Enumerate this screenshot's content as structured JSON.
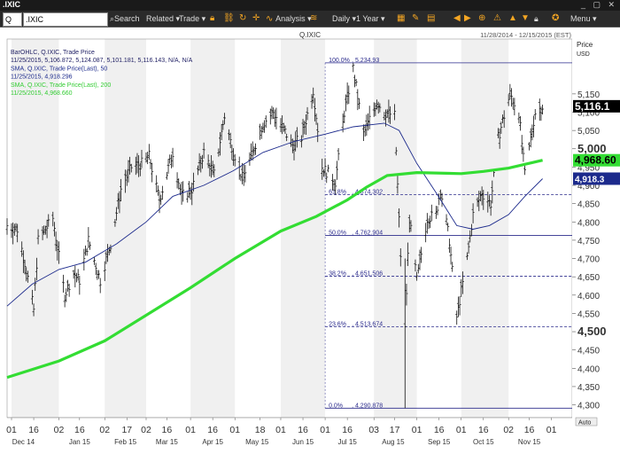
{
  "window": {
    "title": ".IXIC",
    "controls": "_ ▢ ✕"
  },
  "toolbar": {
    "link_indicator": "Q",
    "symbol": ".IXIC",
    "search": "Search",
    "related": "Related ▾",
    "trade": "Trade ▾",
    "analysis": "Analysis ▾",
    "period": "Daily ▾",
    "range": "1 Year ▾",
    "menu": "Menu ▾"
  },
  "chart_data": {
    "type": "line",
    "header": {
      "symbol": "Q.IXIC",
      "date_range": "11/28/2014 - 12/15/2015 (EST)",
      "info_lines": [
        {
          "text": "BarOHLC, Q.IXIC, Trade Price",
          "color": "#222266"
        },
        {
          "text": "11/25/2015, 5,106.872, 5,124.087, 5,101.181, 5,116.143, N/A, N/A",
          "color": "#222266"
        },
        {
          "text": "SMA, Q.IXIC, Trade Price(Last), 50",
          "color": "#1c2a8c"
        },
        {
          "text": "11/25/2015, 4,918.296",
          "color": "#1c2a8c"
        },
        {
          "text": "SMA, Q.IXIC, Trade Price(Last), 200",
          "color": "#33cc33"
        },
        {
          "text": "11/25/2015, 4,968.660",
          "color": "#33cc33"
        }
      ]
    },
    "y_axis": {
      "title": "Price",
      "unit": "USD",
      "ylim": [
        4265,
        5300
      ],
      "ticks": [
        4300,
        4350,
        4400,
        4450,
        4500,
        4550,
        4600,
        4650,
        4700,
        4750,
        4800,
        4850,
        4900,
        4950,
        5000,
        5050,
        5100,
        5150
      ],
      "labels": [
        "4,300",
        "4,350",
        "4,400",
        "4,450",
        "4,500",
        "4,550",
        "4,600",
        "4,650",
        "4,700",
        "4,750",
        "4,800",
        "4,850",
        "4,900",
        "4,950",
        "5,000",
        "5,050",
        "5,100",
        "5,150"
      ],
      "major": [
        4500,
        5000
      ],
      "auto_label": "Auto"
    },
    "x_axis": {
      "start_date": "2014-11-28",
      "end_date": "2015-12-15",
      "day_ticks": [
        {
          "date": "2014-12-01",
          "label": "01"
        },
        {
          "date": "2014-12-16",
          "label": "16"
        },
        {
          "date": "2015-01-02",
          "label": "02"
        },
        {
          "date": "2015-01-16",
          "label": "16"
        },
        {
          "date": "2015-02-02",
          "label": "02"
        },
        {
          "date": "2015-02-17",
          "label": "17"
        },
        {
          "date": "2015-03-02",
          "label": "02"
        },
        {
          "date": "2015-03-16",
          "label": "16"
        },
        {
          "date": "2015-04-01",
          "label": "01"
        },
        {
          "date": "2015-04-16",
          "label": "16"
        },
        {
          "date": "2015-05-01",
          "label": "01"
        },
        {
          "date": "2015-05-18",
          "label": "18"
        },
        {
          "date": "2015-06-01",
          "label": "01"
        },
        {
          "date": "2015-06-16",
          "label": "16"
        },
        {
          "date": "2015-07-01",
          "label": "01"
        },
        {
          "date": "2015-07-16",
          "label": "16"
        },
        {
          "date": "2015-08-03",
          "label": "03"
        },
        {
          "date": "2015-08-17",
          "label": "17"
        },
        {
          "date": "2015-09-01",
          "label": "01"
        },
        {
          "date": "2015-09-16",
          "label": "16"
        },
        {
          "date": "2015-10-01",
          "label": "01"
        },
        {
          "date": "2015-10-16",
          "label": "16"
        },
        {
          "date": "2015-11-02",
          "label": "02"
        },
        {
          "date": "2015-11-16",
          "label": "16"
        },
        {
          "date": "2015-12-01",
          "label": "01"
        }
      ],
      "months": [
        {
          "date": "2014-12-09",
          "label": "Dec 14"
        },
        {
          "date": "2015-01-16",
          "label": "Jan 15"
        },
        {
          "date": "2015-02-16",
          "label": "Feb 15"
        },
        {
          "date": "2015-03-16",
          "label": "Mar 15"
        },
        {
          "date": "2015-04-16",
          "label": "Apr 15"
        },
        {
          "date": "2015-05-16",
          "label": "May 15"
        },
        {
          "date": "2015-06-16",
          "label": "Jun 15"
        },
        {
          "date": "2015-07-16",
          "label": "Jul 15"
        },
        {
          "date": "2015-08-16",
          "label": "Aug 15"
        },
        {
          "date": "2015-09-16",
          "label": "Sep 15"
        },
        {
          "date": "2015-10-16",
          "label": "Oct 15"
        },
        {
          "date": "2015-11-16",
          "label": "Nov 15"
        }
      ]
    },
    "fibonacci": {
      "start_date": "2015-07-01",
      "levels": [
        {
          "pct": "100.0%",
          "value": 5234.93,
          "label": "5,234.93"
        },
        {
          "pct": "61.8%",
          "value": 4874.302,
          "label": "4,874.302"
        },
        {
          "pct": "50.0%",
          "value": 4762.904,
          "label": "4,762.904"
        },
        {
          "pct": "38.2%",
          "value": 4651.506,
          "label": "4,651.506"
        },
        {
          "pct": "23.6%",
          "value": 4513.674,
          "label": "4,513.674"
        },
        {
          "pct": "0.0%",
          "value": 4290.878,
          "label": "4,290.878"
        }
      ]
    },
    "price_path": [
      [
        "2014-11-28",
        4790
      ],
      [
        "2014-12-05",
        4780
      ],
      [
        "2014-12-10",
        4690
      ],
      [
        "2014-12-16",
        4560
      ],
      [
        "2014-12-19",
        4750
      ],
      [
        "2014-12-29",
        4810
      ],
      [
        "2015-01-06",
        4600
      ],
      [
        "2015-01-12",
        4660
      ],
      [
        "2015-01-16",
        4640
      ],
      [
        "2015-01-22",
        4750
      ],
      [
        "2015-01-30",
        4640
      ],
      [
        "2015-02-06",
        4740
      ],
      [
        "2015-02-13",
        4890
      ],
      [
        "2015-02-20",
        4950
      ],
      [
        "2015-02-27",
        4960
      ],
      [
        "2015-03-04",
        4980
      ],
      [
        "2015-03-11",
        4860
      ],
      [
        "2015-03-20",
        4990
      ],
      [
        "2015-03-26",
        4870
      ],
      [
        "2015-04-02",
        4890
      ],
      [
        "2015-04-10",
        4990
      ],
      [
        "2015-04-17",
        4930
      ],
      [
        "2015-04-24",
        5090
      ],
      [
        "2015-04-28",
        5020
      ],
      [
        "2015-05-06",
        4920
      ],
      [
        "2015-05-12",
        4980
      ],
      [
        "2015-05-20",
        5070
      ],
      [
        "2015-05-27",
        5100
      ],
      [
        "2015-06-02",
        5060
      ],
      [
        "2015-06-09",
        5010
      ],
      [
        "2015-06-15",
        5030
      ],
      [
        "2015-06-23",
        5160
      ],
      [
        "2015-06-29",
        4950
      ],
      [
        "2015-07-08",
        4910
      ],
      [
        "2015-07-14",
        5100
      ],
      [
        "2015-07-20",
        5220
      ],
      [
        "2015-07-27",
        5040
      ],
      [
        "2015-08-05",
        5130
      ],
      [
        "2015-08-10",
        5100
      ],
      [
        "2015-08-17",
        5090
      ],
      [
        "2015-08-21",
        4710
      ],
      [
        "2015-08-24",
        4506
      ],
      [
        "2015-08-27",
        4810
      ],
      [
        "2015-09-01",
        4640
      ],
      [
        "2015-09-08",
        4810
      ],
      [
        "2015-09-14",
        4820
      ],
      [
        "2015-09-17",
        4890
      ],
      [
        "2015-09-23",
        4750
      ],
      [
        "2015-09-28",
        4540
      ],
      [
        "2015-10-05",
        4700
      ],
      [
        "2015-10-09",
        4820
      ],
      [
        "2015-10-15",
        4880
      ],
      [
        "2015-10-21",
        4850
      ],
      [
        "2015-10-26",
        5030
      ],
      [
        "2015-11-03",
        5150
      ],
      [
        "2015-11-09",
        5100
      ],
      [
        "2015-11-13",
        4930
      ],
      [
        "2015-11-20",
        5100
      ],
      [
        "2015-11-25",
        5116
      ]
    ],
    "series": [
      {
        "name": "SMA, Q.IXIC, Trade Price(Last), 50",
        "color": "#1c2a8c",
        "values": [
          [
            "2014-11-28",
            4570
          ],
          [
            "2014-12-15",
            4630
          ],
          [
            "2015-01-02",
            4670
          ],
          [
            "2015-01-20",
            4690
          ],
          [
            "2015-02-10",
            4740
          ],
          [
            "2015-03-02",
            4800
          ],
          [
            "2015-03-20",
            4870
          ],
          [
            "2015-04-10",
            4900
          ],
          [
            "2015-04-30",
            4940
          ],
          [
            "2015-05-20",
            4990
          ],
          [
            "2015-06-10",
            5020
          ],
          [
            "2015-07-01",
            5040
          ],
          [
            "2015-07-20",
            5060
          ],
          [
            "2015-08-10",
            5070
          ],
          [
            "2015-08-20",
            5050
          ],
          [
            "2015-09-01",
            4960
          ],
          [
            "2015-09-14",
            4880
          ],
          [
            "2015-09-28",
            4790
          ],
          [
            "2015-10-09",
            4780
          ],
          [
            "2015-10-20",
            4790
          ],
          [
            "2015-11-02",
            4820
          ],
          [
            "2015-11-13",
            4870
          ],
          [
            "2015-11-25",
            4918.296
          ]
        ]
      },
      {
        "name": "SMA, Q.IXIC, Trade Price(Last), 200",
        "color": "#33dd33",
        "values": [
          [
            "2014-11-28",
            4375
          ],
          [
            "2015-01-02",
            4420
          ],
          [
            "2015-02-02",
            4475
          ],
          [
            "2015-03-02",
            4545
          ],
          [
            "2015-04-01",
            4620
          ],
          [
            "2015-05-01",
            4700
          ],
          [
            "2015-06-01",
            4775
          ],
          [
            "2015-06-25",
            4815
          ],
          [
            "2015-07-16",
            4860
          ],
          [
            "2015-07-29",
            4895
          ],
          [
            "2015-08-12",
            4927
          ],
          [
            "2015-09-01",
            4935
          ],
          [
            "2015-10-01",
            4932
          ],
          [
            "2015-10-16",
            4938
          ],
          [
            "2015-11-02",
            4947
          ],
          [
            "2015-11-25",
            4968.66
          ]
        ]
      }
    ],
    "last_price_labels": [
      {
        "value": 5116.143,
        "label": "5,116.1",
        "bg": "#000000",
        "fg": "#ffffff"
      },
      {
        "value": 4968.66,
        "label": "4,968.60",
        "bg": "#33dd33",
        "fg": "#000000"
      },
      {
        "value": 4918.296,
        "label": "4,918.3",
        "bg": "#1c2a8c",
        "fg": "#ffffff"
      }
    ]
  }
}
